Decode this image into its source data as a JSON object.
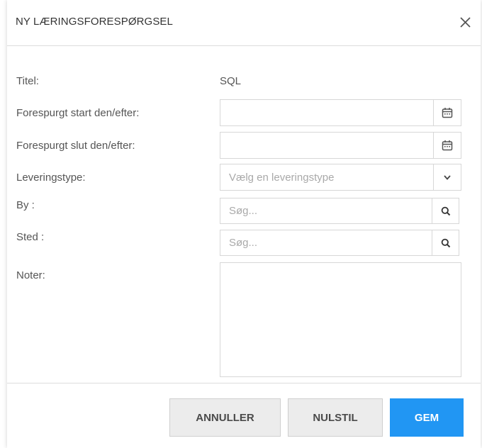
{
  "dialog": {
    "title": "NY LÆRINGSFORESPØRGSEL",
    "close_icon": "close-icon"
  },
  "form": {
    "title_label": "Titel:",
    "title_value": "SQL",
    "start_label": "Forespurgt start den/efter:",
    "start_value": "",
    "end_label": "Forespurgt slut den/efter:",
    "end_value": "",
    "delivery_label": "Leveringstype:",
    "delivery_placeholder": "Vælg en leveringstype",
    "city_label": "By :",
    "city_placeholder": "Søg...",
    "place_label": "Sted :",
    "place_placeholder": "Søg...",
    "notes_label": "Noter:",
    "notes_value": ""
  },
  "icons": {
    "calendar": "calendar-icon",
    "chevron": "chevron-down-icon",
    "search": "search-icon"
  },
  "buttons": {
    "cancel": "ANNULLER",
    "reset": "NULSTIL",
    "save": "GEM"
  },
  "colors": {
    "primary": "#2196f3",
    "secondary_bg": "#ececec",
    "border": "#d7d7d7"
  }
}
